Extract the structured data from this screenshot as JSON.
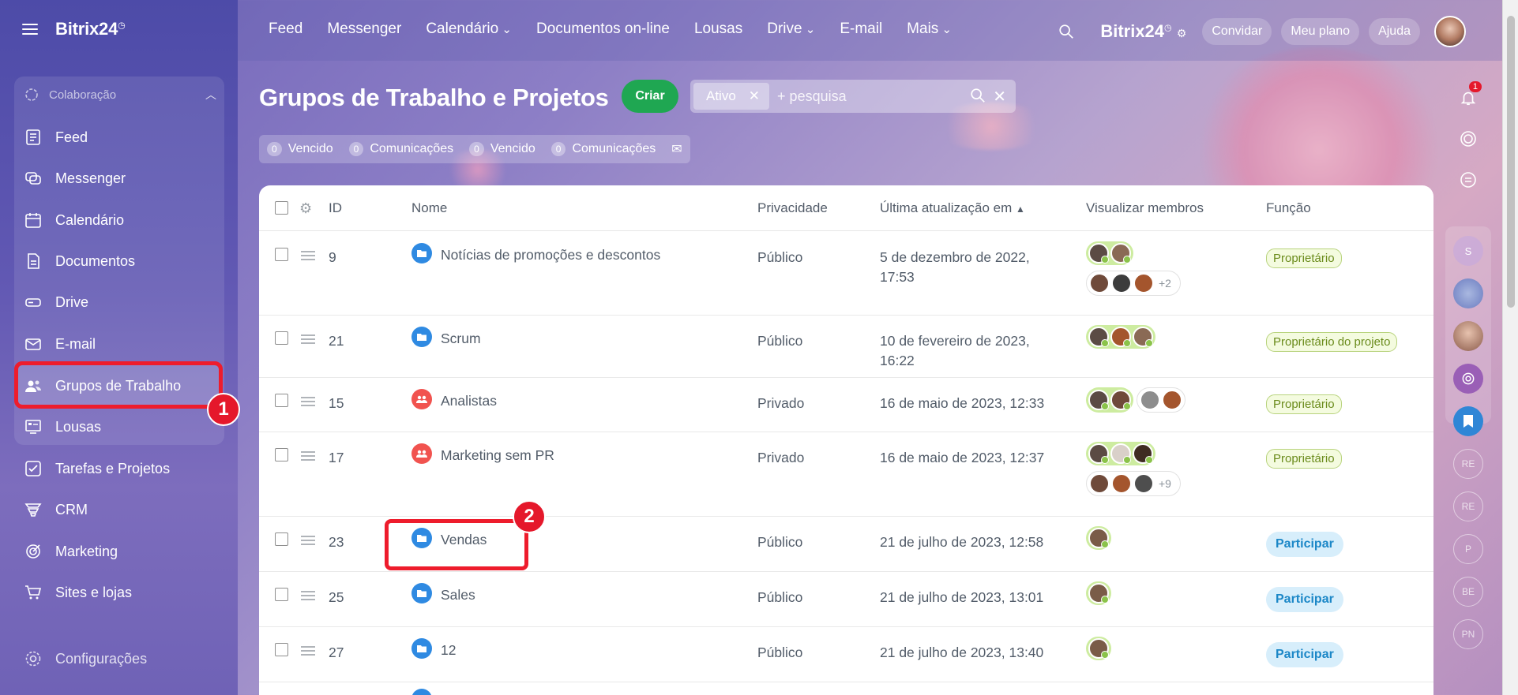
{
  "brand": {
    "name": "Bitrix24",
    "mark": "◷"
  },
  "sidebar": {
    "section_label": "Colaboração",
    "items": [
      {
        "label": "Feed",
        "icon": "feed-icon"
      },
      {
        "label": "Messenger",
        "icon": "messenger-icon"
      },
      {
        "label": "Calendário",
        "icon": "calendar-icon"
      },
      {
        "label": "Documentos",
        "icon": "documents-icon"
      },
      {
        "label": "Drive",
        "icon": "drive-icon"
      },
      {
        "label": "E-mail",
        "icon": "mail-icon"
      },
      {
        "label": "Grupos de Trabalho",
        "icon": "groups-icon"
      },
      {
        "label": "Lousas",
        "icon": "boards-icon"
      },
      {
        "label": "Tarefas e Projetos",
        "icon": "tasks-icon"
      },
      {
        "label": "CRM",
        "icon": "crm-icon"
      },
      {
        "label": "Marketing",
        "icon": "marketing-icon"
      },
      {
        "label": "Sites e lojas",
        "icon": "cart-icon"
      }
    ],
    "settings_label": "Configurações"
  },
  "topnav": {
    "items": [
      "Feed",
      "Messenger",
      "Calendário",
      "Documentos on-line",
      "Lousas",
      "Drive",
      "E-mail",
      "Mais"
    ],
    "invite": "Convidar",
    "plan": "Meu plano",
    "help": "Ajuda"
  },
  "page": {
    "title": "Grupos de Trabalho e Projetos",
    "create": "Criar",
    "filter_chip": "Ativo",
    "search_placeholder": "+ pesquisa"
  },
  "counters": [
    {
      "n": "0",
      "label": "Vencido"
    },
    {
      "n": "0",
      "label": "Comunicações"
    },
    {
      "n": "0",
      "label": "Vencido"
    },
    {
      "n": "0",
      "label": "Comunicações"
    }
  ],
  "table": {
    "headers": {
      "id": "ID",
      "name": "Nome",
      "privacy": "Privacidade",
      "updated": "Última atualização em",
      "members": "Visualizar membros",
      "role": "Função"
    },
    "rows": [
      {
        "id": "9",
        "name": "Notícias de promoções e descontos",
        "type": "project",
        "privacy": "Público",
        "updated1": "5 de dezembro de 2022,",
        "updated2": "17:53",
        "role": "Proprietário",
        "more": "+2"
      },
      {
        "id": "21",
        "name": "Scrum",
        "type": "project",
        "privacy": "Público",
        "updated1": "10 de fevereiro de 2023,",
        "updated2": "16:22",
        "role": "Proprietário do projeto",
        "more": ""
      },
      {
        "id": "15",
        "name": "Analistas",
        "type": "group",
        "privacy": "Privado",
        "updated1": "16 de maio de 2023, 12:33",
        "updated2": "",
        "role": "Proprietário",
        "more": ""
      },
      {
        "id": "17",
        "name": "Marketing sem PR",
        "type": "group",
        "privacy": "Privado",
        "updated1": "16 de maio de 2023, 12:37",
        "updated2": "",
        "role": "Proprietário",
        "more": "+9"
      },
      {
        "id": "23",
        "name": "Vendas",
        "type": "project",
        "privacy": "Público",
        "updated1": "21 de julho de 2023, 12:58",
        "updated2": "",
        "role": "Participar",
        "more": ""
      },
      {
        "id": "25",
        "name": "Sales",
        "type": "project",
        "privacy": "Público",
        "updated1": "21 de julho de 2023, 13:01",
        "updated2": "",
        "role": "Participar",
        "more": ""
      },
      {
        "id": "27",
        "name": "12",
        "type": "project",
        "privacy": "Público",
        "updated1": "21 de julho de 2023, 13:40",
        "updated2": "",
        "role": "Participar",
        "more": ""
      }
    ]
  },
  "callouts": {
    "one": "1",
    "two": "2"
  },
  "notifications": {
    "count": "1"
  },
  "rail_initials": [
    "S",
    "RE",
    "RE",
    "P",
    "BE",
    "PN"
  ],
  "colors": {
    "accent_green": "#1fa752",
    "callout_red": "#ee1c2c",
    "link_blue": "#2f8ae2"
  }
}
